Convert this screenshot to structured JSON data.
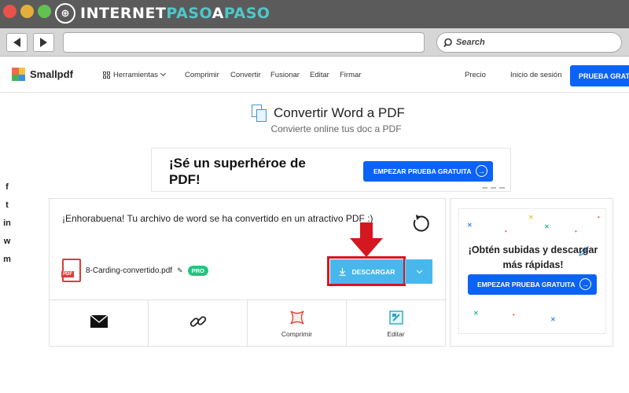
{
  "watermark": {
    "text_part1": "INTERNET",
    "text_part2": "PASO",
    "text_part3": "A",
    "text_part4": "PASO",
    "accent_color": "#50c7c9"
  },
  "browser": {
    "search_placeholder": "Search",
    "url_value": ""
  },
  "site": {
    "logo": "Smallpdf",
    "nav": {
      "tools": "Herramientas",
      "compress": "Comprimir",
      "convert": "Convertir",
      "merge": "Fusionar",
      "edit": "Editar",
      "sign": "Firmar",
      "pricing": "Precio",
      "login": "Inicio de sesión",
      "trial": "PRUEBA GRATUITA"
    },
    "brand_color": "#0b63f6"
  },
  "page": {
    "title": "Convertir Word a PDF",
    "subtitle": "Convierte online tus doc a PDF"
  },
  "ad": {
    "headline": "¡Sé un superhéroe de PDF!",
    "button": "EMPEZAR PRUEBA GRATUITA"
  },
  "social": [
    "f",
    "t",
    "in",
    "w",
    "m"
  ],
  "result": {
    "message": "¡Enhorabuena! Tu archivo de word se ha convertido en un atractivo PDF :)",
    "file_name": "8-Carding-convertido.pdf",
    "pdf_label": "PDF",
    "badge": "PRO",
    "download_label": "DESCARGAR",
    "download_color": "#48b8ec",
    "highlight_color": "#d5171f",
    "actions": [
      {
        "label": "",
        "icon": "envelope-icon"
      },
      {
        "label": "",
        "icon": "link-icon"
      },
      {
        "label": "Comprimir",
        "icon": "compress-icon"
      },
      {
        "label": "Editar",
        "icon": "edit-icon"
      }
    ]
  },
  "promo": {
    "title": "¡Obtén subidas y descargar más rápidas!",
    "button": "EMPEZAR PRUEBA GRATUITA"
  }
}
